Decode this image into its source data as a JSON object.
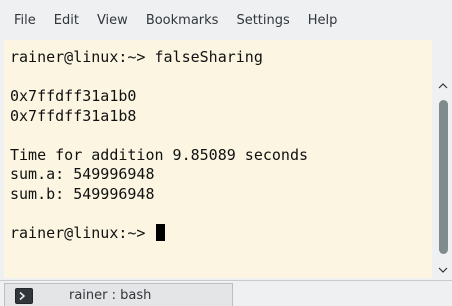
{
  "menubar": {
    "items": [
      {
        "label": "File"
      },
      {
        "label": "Edit"
      },
      {
        "label": "View"
      },
      {
        "label": "Bookmarks"
      },
      {
        "label": "Settings"
      },
      {
        "label": "Help"
      }
    ]
  },
  "terminal": {
    "background": "#fbf5e1",
    "foreground": "#111111",
    "lines": [
      "rainer@linux:~> falseSharing",
      "",
      "0x7ffdff31a1b0",
      "0x7ffdff31a1b8",
      "",
      "Time for addition 9.85089 seconds",
      "sum.a: 549996948",
      "sum.b: 549996948",
      "",
      "rainer@linux:~> "
    ]
  },
  "scrollbar": {
    "thumb_color": "#7f8c8d"
  },
  "tabs": [
    {
      "label": "rainer : bash",
      "icon": "terminal-icon"
    }
  ]
}
